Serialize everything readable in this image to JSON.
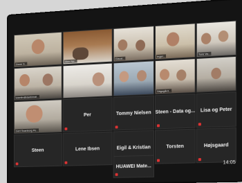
{
  "video_tiles": [
    {
      "caption": "Zoom S..."
    },
    {
      "caption": "Sten Nø..."
    },
    {
      "caption": "Claud..."
    },
    {
      "caption": "Inger..."
    },
    {
      "caption": "Ture Vo..."
    },
    {
      "caption": "kasnlin@danbmail..."
    },
    {
      "caption": ""
    },
    {
      "caption": ""
    },
    {
      "caption": "Stigsgård..."
    },
    {
      "caption": ""
    },
    {
      "caption": "Gert Svanborg Pe..."
    }
  ],
  "name_tiles": [
    {
      "name": "Per"
    },
    {
      "name": "Tommy Nielsen"
    },
    {
      "name": "Steen - Data og..."
    },
    {
      "name": "Lisa og Peter"
    },
    {
      "name": "Steen"
    },
    {
      "name": "Lene Ibsen"
    },
    {
      "name": "Eigil & Kristian"
    },
    {
      "name": "Torsten"
    },
    {
      "name": "Højsgaard"
    },
    {
      "name": "HUAWEI Mate..."
    }
  ],
  "clock": "14:05",
  "mute_icon": "muted-mic-icon"
}
